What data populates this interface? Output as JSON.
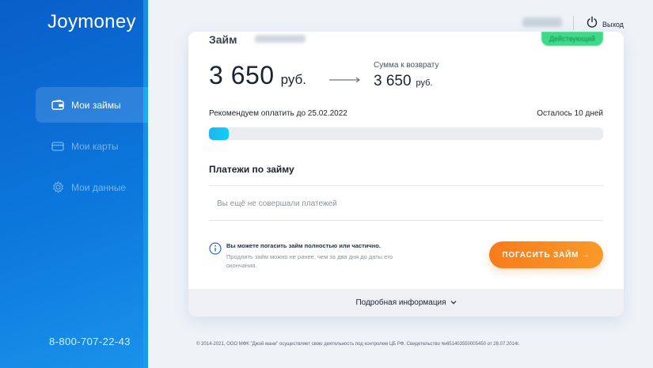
{
  "sidebar": {
    "logo": "Joymoney",
    "items": [
      {
        "label": "Мои займы",
        "icon": "wallet-icon",
        "active": true
      },
      {
        "label": "Мои карты",
        "icon": "card-icon",
        "active": false
      },
      {
        "label": "Мои данные",
        "icon": "gear-icon",
        "active": false
      }
    ],
    "phone": "8-800-707-22-43"
  },
  "header": {
    "logout_label": "Выход",
    "logout_icon": "power-icon"
  },
  "loan": {
    "title": "Займ",
    "status": "Действующий",
    "amount": "3 650",
    "currency": "руб.",
    "return_label": "Сумма к возврату",
    "return_amount": "3 650",
    "return_currency": "руб.",
    "recommend_text": "Рекомендуем оплатить до 25.02.2022",
    "remaining_text": "Осталось 10 дней",
    "progress_fraction": 0.05,
    "payments_title": "Платежи по займу",
    "no_payments_text": "Вы ещё не совершали платежей",
    "info_title": "Вы можете погасить займ полностью или частично.",
    "info_text": "Продлить займ можно не ранее, чем за два дня до даты его окончания.",
    "pay_button": "ПОГАСИТЬ ЗАЙМ →",
    "details_label": "Подробная информация"
  },
  "footer": {
    "text": "© 2014-2021, ООО МФК \"Джой мани\" осуществляет свою деятельность под контролем ЦБ РФ. Свидетельство №651403550005450 от 28.07.2014г."
  },
  "colors": {
    "sidebar": "#0b6fd6",
    "accent_orange": "#f77c1b",
    "progress": "#1fb4f0",
    "status_green": "#3fd98a"
  }
}
